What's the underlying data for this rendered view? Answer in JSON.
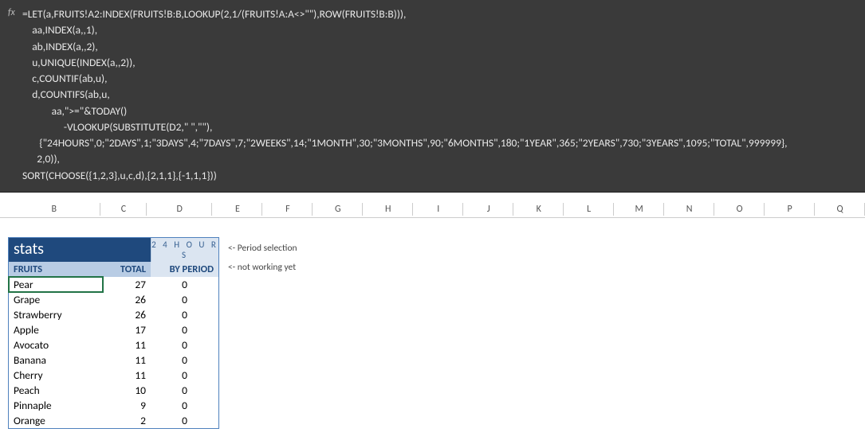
{
  "formula_bar": {
    "fx_label": "fx",
    "text": "=LET(a,FRUITS!A2:INDEX(FRUITS!B:B,LOOKUP(2,1/(FRUITS!A:A<>\"\"),ROW(FRUITS!B:B))),\n    aa,INDEX(a,,1),\n    ab,INDEX(a,,2),\n    u,UNIQUE(INDEX(a,,2)),\n    c,COUNTIF(ab,u),\n    d,COUNTIFS(ab,u,\n            aa,\">=\"&TODAY()\n                 -VLOOKUP(SUBSTITUTE(D2,\" \",\"\"),\n       {\"24HOURS\",0;\"2DAYS\",1;\"3DAYS\",4;\"7DAYS\",7;\"2WEEKS\",14;\"1MONTH\",30;\"3MONTHS\",90;\"6MONTHS\",180;\"1YEAR\",365;\"2YEARS\",730;\"3YEARS\",1095;\"TOTAL\",999999},\n      2,0)),\nSORT(CHOOSE({1,2,3},u,c,d),{2,1,1},{-1,1,1}))"
  },
  "columns": [
    "B",
    "C",
    "D",
    "E",
    "F",
    "G",
    "H",
    "I",
    "J",
    "K",
    "L",
    "M",
    "N",
    "O",
    "P",
    "Q"
  ],
  "stats": {
    "title": "stats",
    "period_value": "2 4 H O U R S",
    "headers": {
      "fruits": "FRUITS",
      "total": "TOTAL",
      "by_period": "BY PERIOD"
    },
    "rows": [
      {
        "fruit": "Pear",
        "total": 27,
        "by_period": 0
      },
      {
        "fruit": "Grape",
        "total": 26,
        "by_period": 0
      },
      {
        "fruit": "Strawberry",
        "total": 26,
        "by_period": 0
      },
      {
        "fruit": "Apple",
        "total": 17,
        "by_period": 0
      },
      {
        "fruit": "Avocato",
        "total": 11,
        "by_period": 0
      },
      {
        "fruit": "Banana",
        "total": 11,
        "by_period": 0
      },
      {
        "fruit": "Cherry",
        "total": 11,
        "by_period": 0
      },
      {
        "fruit": "Peach",
        "total": 10,
        "by_period": 0
      },
      {
        "fruit": "Pinnaple",
        "total": 9,
        "by_period": 0
      },
      {
        "fruit": "Orange",
        "total": 2,
        "by_period": 0
      }
    ]
  },
  "annotations": {
    "period": "<- Period selection",
    "header": "<- not working yet"
  }
}
